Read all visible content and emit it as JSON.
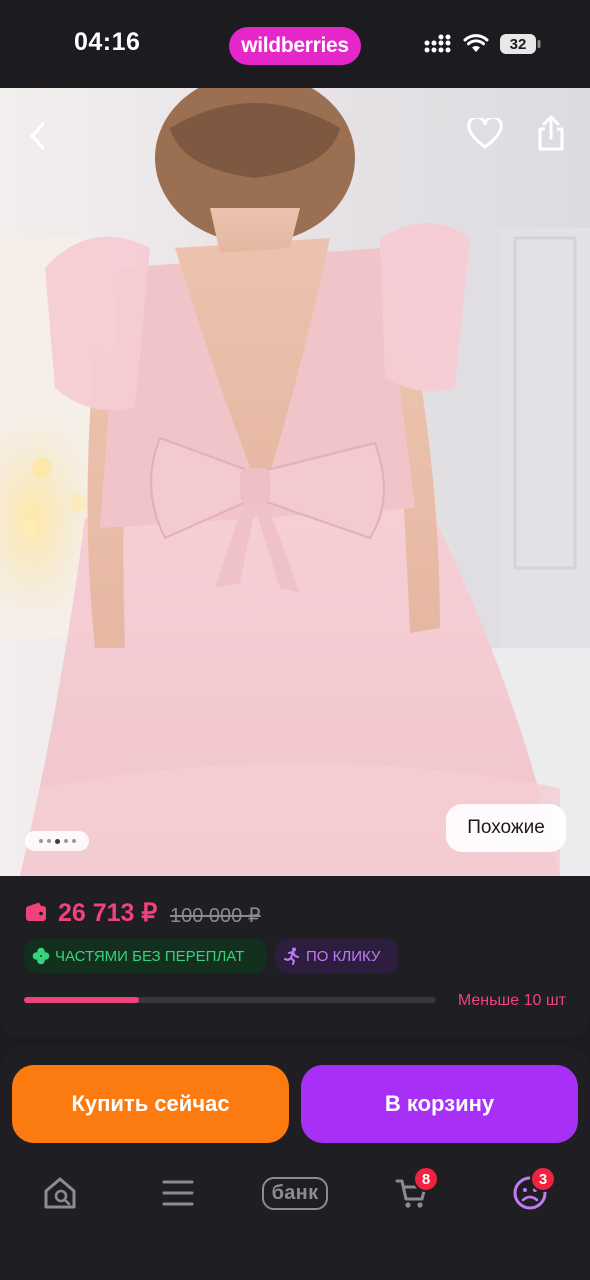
{
  "status_bar": {
    "time": "04:16",
    "brand": "wildberries",
    "battery": "32"
  },
  "product": {
    "gallery_page": 3,
    "gallery_total": 5,
    "similar_label": "Похожие"
  },
  "price": {
    "current": "26 713 ₽",
    "old": "100 000 ₽",
    "badges": [
      {
        "label": "ЧАСТЯМИ БЕЗ ПЕРЕПЛАТ",
        "icon": "clover-icon"
      },
      {
        "label": "ПО КЛИКУ",
        "icon": "running-person-icon"
      }
    ],
    "stock_level": 0.28,
    "stock_text": "Меньше 10 шт"
  },
  "actions": {
    "buy_now": "Купить сейчас",
    "add_to_cart": "В корзину"
  },
  "nav": {
    "bank_label": "банк",
    "cart_count": "8",
    "profile_count": "3"
  },
  "colors": {
    "accent_pink": "#f0427b",
    "brand_magenta": "#e526c9",
    "buy_orange": "#fc7b11",
    "cart_purple": "#a72ff6",
    "installments_green": "#36d57a",
    "badge_red": "#f0223f"
  }
}
